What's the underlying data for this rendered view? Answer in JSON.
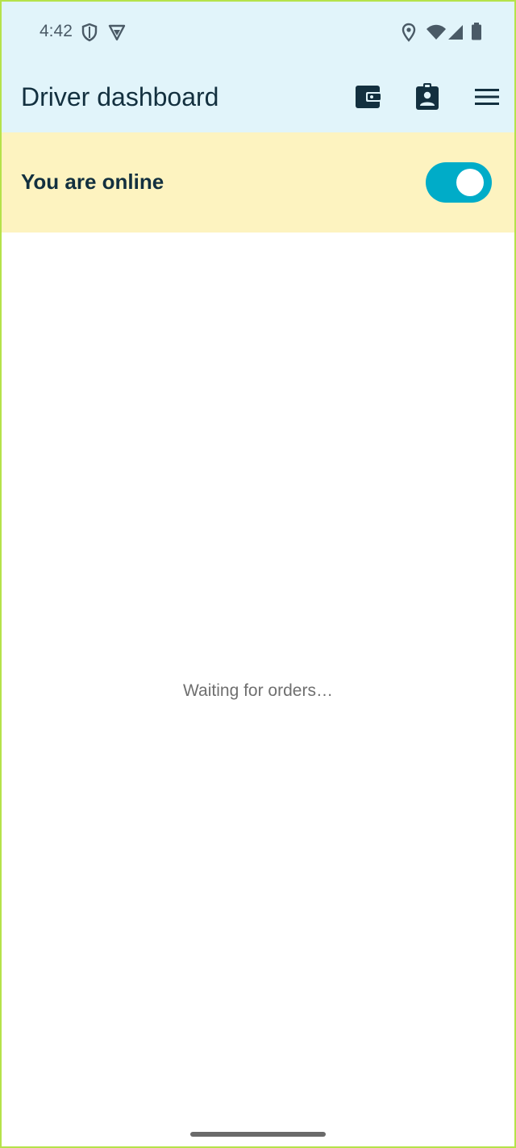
{
  "status_bar": {
    "time": "4:42",
    "icons": [
      "shield-icon",
      "vpn-icon",
      "location-icon",
      "wifi-icon",
      "signal-icon",
      "battery-icon"
    ]
  },
  "app_bar": {
    "title": "Driver dashboard",
    "actions": [
      "wallet-icon",
      "profile-clipboard-icon",
      "menu-icon"
    ]
  },
  "online_banner": {
    "label": "You are online",
    "toggle_on": true
  },
  "main": {
    "empty_message": "Waiting for orders…"
  },
  "colors": {
    "header_bg": "#e1f4fa",
    "banner_bg": "#fdf3c0",
    "toggle_accent": "#00acc8",
    "text_dark": "#13303f"
  }
}
